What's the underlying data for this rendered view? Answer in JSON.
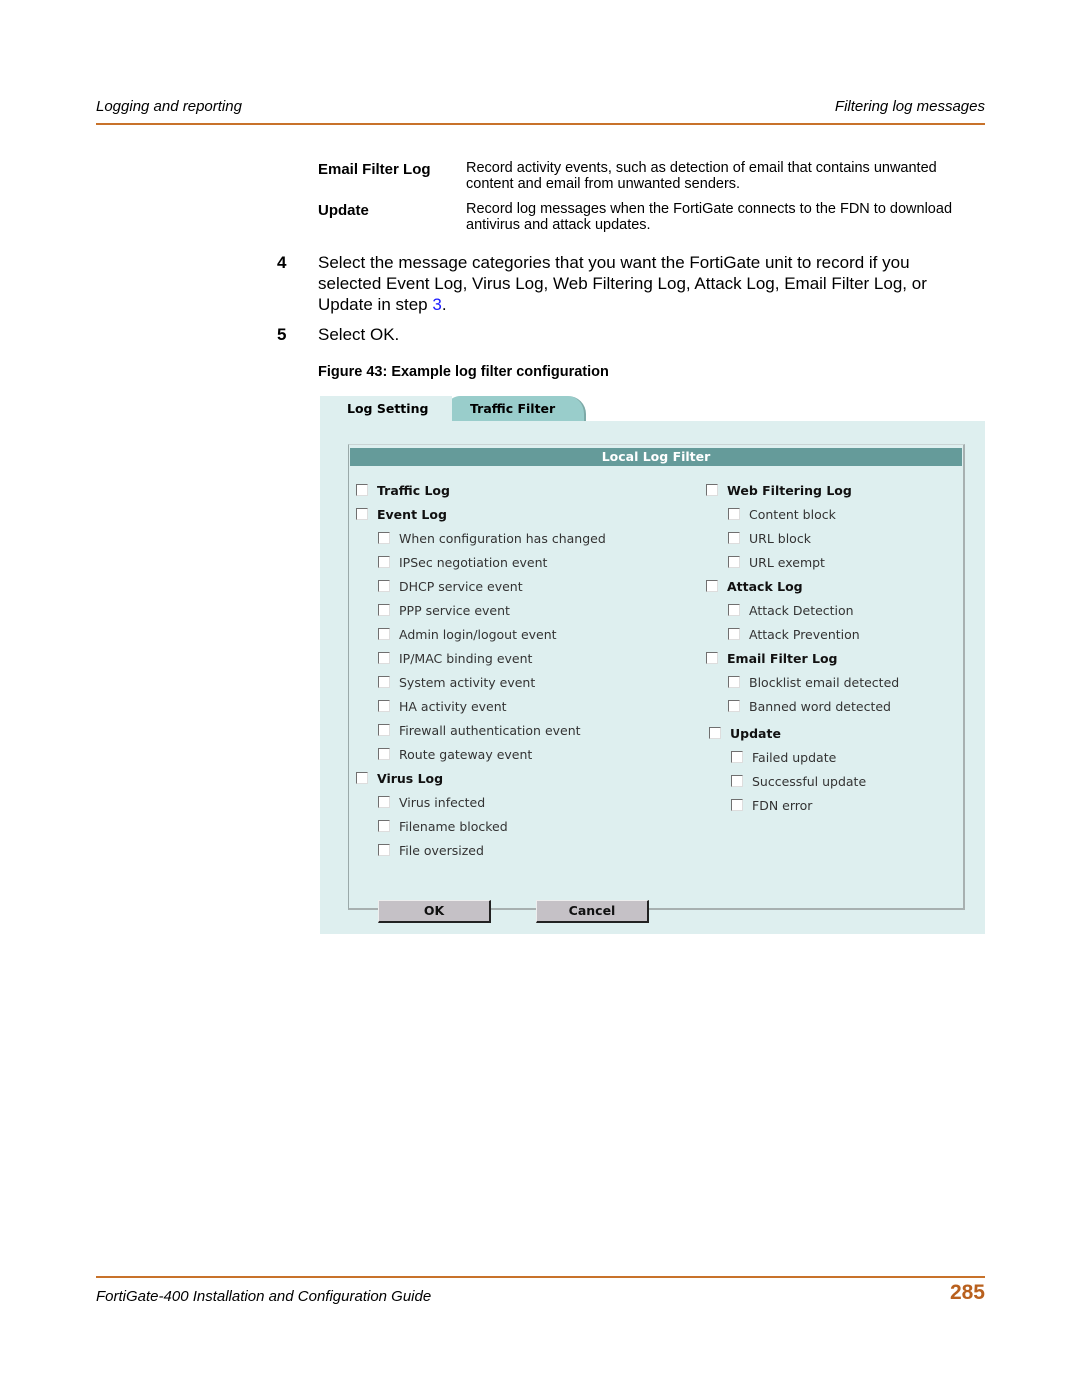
{
  "header": {
    "left": "Logging and reporting",
    "right": "Filtering log messages"
  },
  "definitions": [
    {
      "term": "Email Filter Log",
      "desc": "Record activity events, such as detection of email that contains unwanted content and email from unwanted senders."
    },
    {
      "term": "Update",
      "desc": "Record log messages when the FortiGate connects to the FDN to download antivirus and attack updates."
    }
  ],
  "steps": [
    {
      "num": "4",
      "text_before": "Select the message categories that you want the FortiGate unit to record if you selected Event Log, Virus Log, Web Filtering Log, Attack Log, Email Filter Log, or Update in step ",
      "link": "3",
      "text_after": "."
    },
    {
      "num": "5",
      "text_before": "Select OK.",
      "link": "",
      "text_after": ""
    }
  ],
  "figure_caption": "Figure 43: Example log filter configuration",
  "ui": {
    "tabs": [
      "Log Setting",
      "Traffic Filter"
    ],
    "box_title": "Local Log Filter",
    "left_column": [
      {
        "label": "Traffic Log",
        "type": "category",
        "checked": false
      },
      {
        "label": "Event Log",
        "type": "category",
        "checked": false
      },
      {
        "label": "When configuration has changed",
        "type": "sub",
        "checked": false
      },
      {
        "label": "IPSec negotiation event",
        "type": "sub",
        "checked": false
      },
      {
        "label": "DHCP service event",
        "type": "sub",
        "checked": false
      },
      {
        "label": "PPP service event",
        "type": "sub",
        "checked": false
      },
      {
        "label": "Admin login/logout event",
        "type": "sub",
        "checked": false
      },
      {
        "label": "IP/MAC binding event",
        "type": "sub",
        "checked": false
      },
      {
        "label": "System activity event",
        "type": "sub",
        "checked": false
      },
      {
        "label": "HA activity event",
        "type": "sub",
        "checked": false
      },
      {
        "label": "Firewall authentication event",
        "type": "sub",
        "checked": false
      },
      {
        "label": "Route gateway event",
        "type": "sub",
        "checked": false
      },
      {
        "label": "Virus Log",
        "type": "category",
        "checked": false
      },
      {
        "label": "Virus infected",
        "type": "sub",
        "checked": false
      },
      {
        "label": "Filename blocked",
        "type": "sub",
        "checked": false
      },
      {
        "label": "File oversized",
        "type": "sub",
        "checked": false
      }
    ],
    "right_column": [
      {
        "label": "Web Filtering Log",
        "type": "category",
        "checked": false
      },
      {
        "label": "Content block",
        "type": "sub",
        "checked": false
      },
      {
        "label": "URL block",
        "type": "sub",
        "checked": false
      },
      {
        "label": "URL exempt",
        "type": "sub",
        "checked": false
      },
      {
        "label": "Attack Log",
        "type": "category",
        "checked": false
      },
      {
        "label": "Attack Detection",
        "type": "sub",
        "checked": false
      },
      {
        "label": "Attack Prevention",
        "type": "sub",
        "checked": false
      },
      {
        "label": "Email Filter Log",
        "type": "category",
        "checked": false
      },
      {
        "label": "Blocklist email detected",
        "type": "sub",
        "checked": false
      },
      {
        "label": "Banned word detected",
        "type": "sub",
        "checked": false
      },
      {
        "label": "Update",
        "type": "category",
        "checked": false
      },
      {
        "label": "Failed update",
        "type": "sub",
        "checked": false
      },
      {
        "label": "Successful update",
        "type": "sub",
        "checked": false
      },
      {
        "label": "FDN error",
        "type": "sub",
        "checked": false
      }
    ],
    "buttons": {
      "ok": "OK",
      "cancel": "Cancel"
    }
  },
  "footer": {
    "title": "FortiGate-400 Installation and Configuration Guide",
    "page_number": "285"
  },
  "colors": {
    "rule": "#c8722a",
    "page_number": "#b8601e",
    "panel_bg": "#deefef",
    "box_header_bg": "#659b9a",
    "tab_active_bg": "#99cdcb",
    "link": "#1a1aff"
  }
}
